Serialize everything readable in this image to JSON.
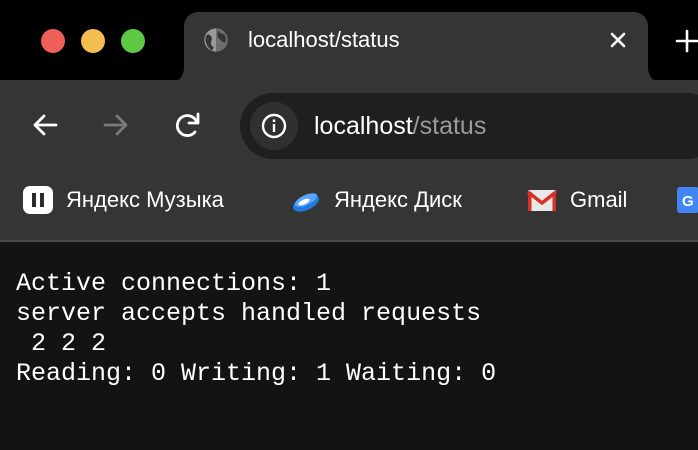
{
  "window": {
    "controls": [
      "close",
      "minimize",
      "maximize"
    ],
    "colors": {
      "close": "#ee5f57",
      "minimize": "#f4bd4f",
      "maximize": "#5ec845"
    }
  },
  "tab": {
    "title": "localhost/status",
    "favicon": "globe-icon",
    "close_icon": "close-icon",
    "new_tab_icon": "plus-icon"
  },
  "toolbar": {
    "back_icon": "arrow-left-icon",
    "forward_icon": "arrow-right-icon",
    "reload_icon": "reload-icon",
    "site_info_icon": "info-icon",
    "url_host": "localhost",
    "url_path": "/status"
  },
  "bookmarks": [
    {
      "label": "Яндекс Музыка",
      "icon": "yandex-music-icon"
    },
    {
      "label": "Яндекс Диск",
      "icon": "yandex-disk-icon"
    },
    {
      "label": "Gmail",
      "icon": "gmail-icon"
    },
    {
      "label": "",
      "icon": "google-translate-icon"
    }
  ],
  "page": {
    "lines": [
      "Active connections: 1 ",
      "server accepts handled requests",
      " 2 2 2 ",
      "Reading: 0 Writing: 1 Waiting: 0 "
    ]
  },
  "colors": {
    "tabstrip_bg": "#000000",
    "toolbar_bg": "#353535",
    "omnibox_bg": "#1f1f1f",
    "page_bg": "#131313",
    "text": "#ffffff",
    "url_path": "#9a9a9a"
  }
}
